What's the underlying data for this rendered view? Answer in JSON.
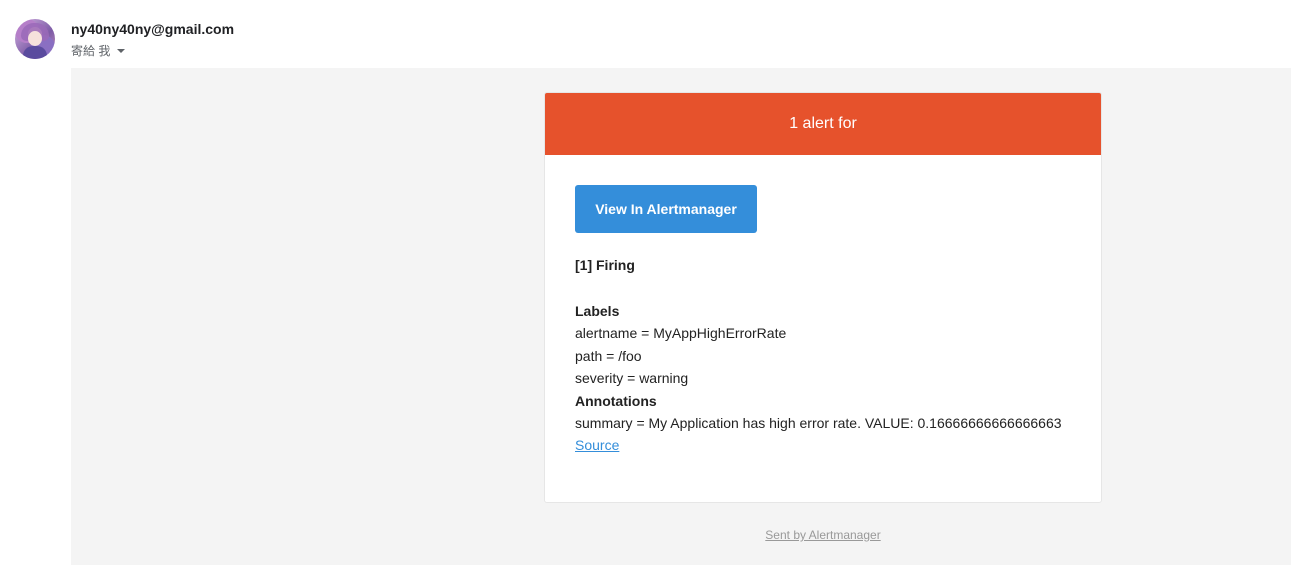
{
  "header": {
    "sender_email": "ny40ny40ny@gmail.com",
    "recipient_text": "寄給 我",
    "avatar_icon": "user-avatar"
  },
  "alert": {
    "header_text": "1 alert for",
    "header_color": "#e6522c",
    "button_label": "View In Alertmanager",
    "button_color": "#348eda",
    "firing_title": "[1] Firing",
    "labels_heading": "Labels",
    "labels": [
      "alertname = MyAppHighErrorRate",
      "path = /foo",
      "severity = warning"
    ],
    "annotations_heading": "Annotations",
    "annotations": [
      "summary = My Application has high error rate. VALUE: 0.16666666666666663"
    ],
    "source_link": "Source"
  },
  "footer": {
    "sent_by": "Sent by Alertmanager"
  }
}
